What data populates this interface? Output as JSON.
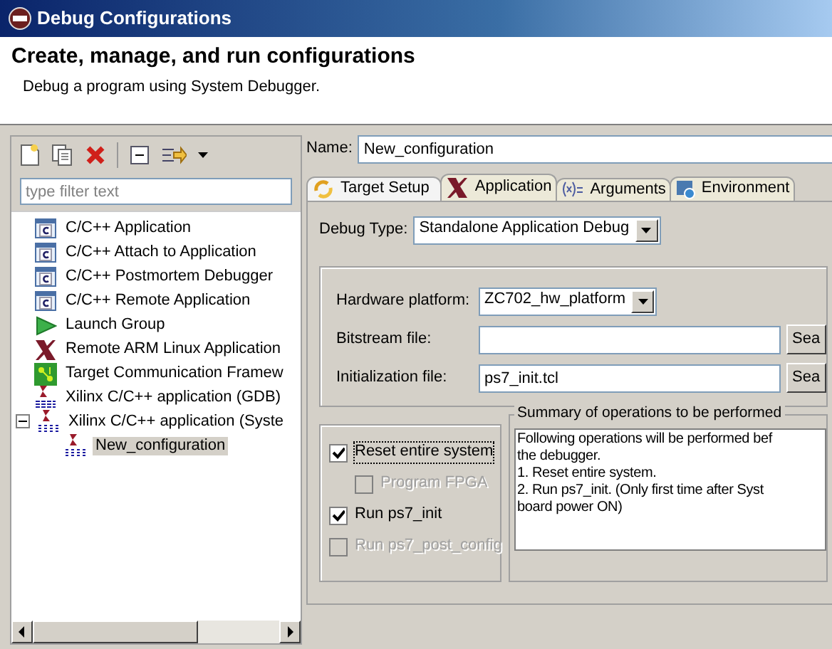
{
  "window": {
    "title": "Debug Configurations"
  },
  "header": {
    "title": "Create, manage, and run configurations",
    "subtitle": "Debug a program using System Debugger."
  },
  "filter": {
    "placeholder": "type filter text"
  },
  "tree": [
    {
      "label": "C/C++ Application",
      "kind": "c",
      "selected": false
    },
    {
      "label": "C/C++ Attach to Application",
      "kind": "c",
      "selected": false
    },
    {
      "label": "C/C++ Postmortem Debugger",
      "kind": "c",
      "selected": false
    },
    {
      "label": "C/C++ Remote Application",
      "kind": "c",
      "selected": false
    },
    {
      "label": "Launch Group",
      "kind": "group",
      "selected": false
    },
    {
      "label": "Remote ARM Linux Application",
      "kind": "xilinx",
      "selected": false
    },
    {
      "label": "Target Communication Framew",
      "kind": "target",
      "selected": false
    },
    {
      "label": "Xilinx C/C++ application (GDB)",
      "kind": "gdb",
      "selected": false
    },
    {
      "label": "Xilinx C/C++ application (Syste",
      "kind": "tcf",
      "selected": false,
      "expanded": true,
      "children": [
        {
          "label": "New_configuration",
          "kind": "tcf",
          "selected": true
        }
      ]
    }
  ],
  "name": {
    "label": "Name:",
    "value": "New_configuration"
  },
  "tabs": [
    {
      "label": "Target Setup",
      "selected": true
    },
    {
      "label": "Application",
      "selected": false
    },
    {
      "label": "Arguments",
      "selected": false
    },
    {
      "label": "Environment",
      "selected": false
    }
  ],
  "debug_type": {
    "label": "Debug Type:",
    "value": "Standalone Application Debug"
  },
  "hardware": [
    {
      "label": "Hardware platform:",
      "kind": "dropdown",
      "value": "ZC702_hw_platform"
    },
    {
      "label": "Bitstream file:",
      "kind": "file",
      "button": "Sea"
    },
    {
      "label": "Initialization file:",
      "kind": "file",
      "value": "ps7_init.tcl",
      "button": "Sea"
    }
  ],
  "options": [
    {
      "label": "Reset entire system",
      "checked": true,
      "disabled": false,
      "indented": false
    },
    {
      "label": "Program FPGA",
      "checked": false,
      "disabled": true,
      "indented": true
    },
    {
      "label": "Run ps7_init",
      "checked": true,
      "disabled": false,
      "indented": false
    },
    {
      "label": "Run ps7_post_config",
      "checked": false,
      "disabled": true,
      "indented": false
    }
  ],
  "summary": {
    "title": "Summary of operations to be performed",
    "lines": [
      "Following operations will be performed bef",
      "the debugger.",
      "1. Reset entire system.",
      "2. Run ps7_init. (Only first time after Syst",
      "board power ON)"
    ]
  }
}
